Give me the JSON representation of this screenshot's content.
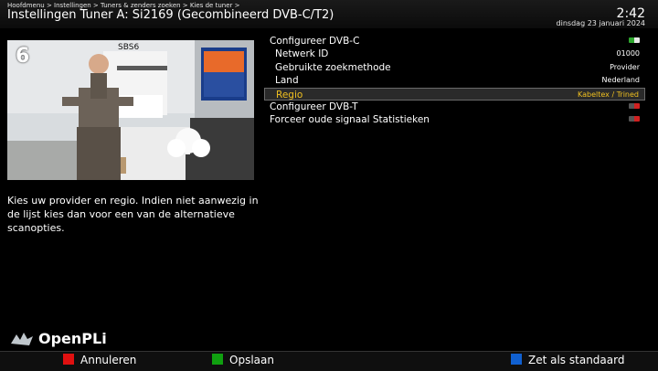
{
  "header": {
    "breadcrumb": "Hoofdmenu > Instellingen > Tuners & zenders zoeken > Kies de tuner >",
    "title": "Instellingen Tuner A: Si2169 (Gecombineerd DVB-C/T2)",
    "time": "2:42",
    "date": "dinsdag 23 januari 2024"
  },
  "preview": {
    "channel_number": "6",
    "channel_name": "SBS6"
  },
  "help_text": "Kies uw provider en regio. Indien niet aanwezig in de lijst kies dan voor een van de alternatieve scanopties.",
  "menu": {
    "items": [
      {
        "label": "Configureer DVB-C",
        "value": "",
        "toggle": "on"
      },
      {
        "label": "Netwerk ID",
        "value": "01000"
      },
      {
        "label": "Gebruikte zoekmethode",
        "value": "Provider"
      },
      {
        "label": "Land",
        "value": "Nederland"
      },
      {
        "label": "Regio",
        "value": "Kabeltex / Trined"
      },
      {
        "label": "Configureer DVB-T",
        "value": "",
        "toggle": "off"
      },
      {
        "label": "Forceer oude signaal Statistieken",
        "value": "",
        "toggle": "off"
      }
    ]
  },
  "brand": "OpenPLi",
  "footer": {
    "buttons": [
      {
        "label": "Annuleren",
        "color": "#e01010"
      },
      {
        "label": "Opslaan",
        "color": "#10a010"
      },
      {
        "label": "Zet als standaard",
        "color": "#1060d0"
      }
    ]
  },
  "colors": {
    "selected_text": "#f0c020",
    "toggle_on": "green-white",
    "toggle_off": "red"
  }
}
